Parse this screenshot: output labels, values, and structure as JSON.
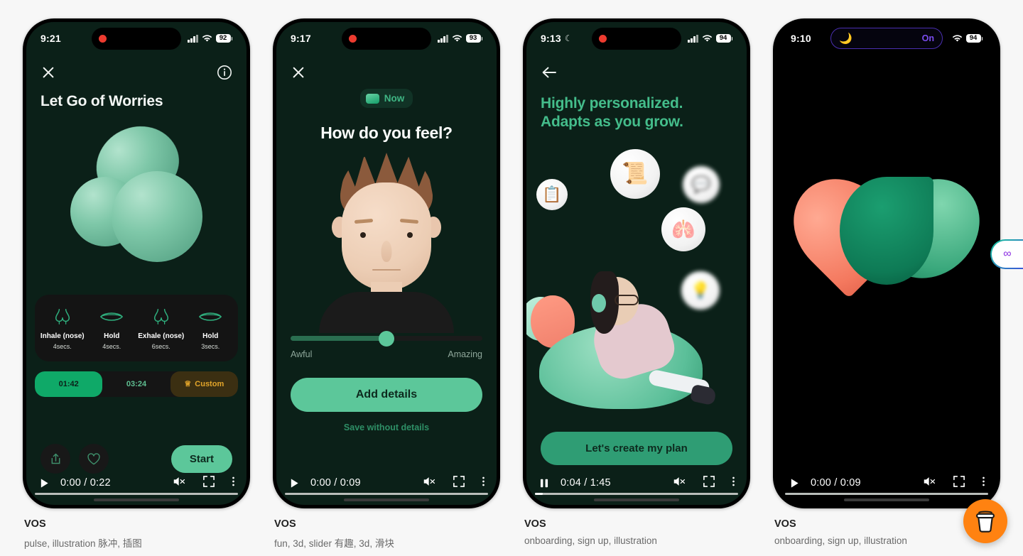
{
  "page": {
    "background": "#f7f7f7"
  },
  "cards": [
    {
      "status": {
        "time": "9:21",
        "battery": "92",
        "moon": ""
      },
      "nav": {
        "close_icon": "close-icon",
        "info_icon": "info-icon"
      },
      "title": "Let Go of Worries",
      "breath_steps": [
        {
          "name": "Inhale (nose)",
          "secs": "4secs.",
          "icon": "nose-icon"
        },
        {
          "name": "Hold",
          "secs": "4secs.",
          "icon": "lips-icon"
        },
        {
          "name": "Exhale (nose)",
          "secs": "6secs.",
          "icon": "nose-icon"
        },
        {
          "name": "Hold",
          "secs": "3secs.",
          "icon": "lips-icon"
        }
      ],
      "durations": [
        {
          "label": "01:42",
          "state": "active"
        },
        {
          "label": "03:24",
          "state": "normal"
        },
        {
          "label": "Custom",
          "state": "custom"
        }
      ],
      "actions": {
        "share_icon": "share-icon",
        "like_icon": "heart-icon",
        "start_label": "Start"
      },
      "video": {
        "current": "0:00",
        "duration": "0:22",
        "time_text": "0:00 / 0:22",
        "state": "paused",
        "progress_pct": 0
      },
      "caption": {
        "title": "VOS",
        "tags": "pulse, illustration 脉冲, 插图"
      }
    },
    {
      "status": {
        "time": "9:17",
        "battery": "93",
        "moon": ""
      },
      "nav": {
        "close_icon": "close-icon"
      },
      "now_pill": "Now",
      "question": "How do you feel?",
      "slider": {
        "value_pct": 50,
        "left_label": "Awful",
        "right_label": "Amazing"
      },
      "cta": "Add details",
      "sub_link": "Save without details",
      "video": {
        "current": "0:00",
        "duration": "0:09",
        "time_text": "0:00 / 0:09",
        "state": "paused",
        "progress_pct": 0
      },
      "caption": {
        "title": "VOS",
        "tags": "fun, 3d, slider 有趣, 3d, 滑块"
      }
    },
    {
      "status": {
        "time": "9:13",
        "battery": "94",
        "moon": "☾"
      },
      "nav": {
        "back_icon": "back-arrow-icon"
      },
      "headline_line1": "Highly personalized.",
      "headline_line2": "Adapts as you grow.",
      "cta": "Let's create my plan",
      "bubbles": [
        "clipboard-icon",
        "scroll-icon",
        "chat-icon",
        "lungs-icon",
        "blurred-icon"
      ],
      "video": {
        "current": "0:04",
        "duration": "1:45",
        "time_text": "0:04 / 1:45",
        "state": "playing",
        "progress_pct": 4
      },
      "caption": {
        "title": "VOS",
        "tags": "onboarding, sign up, illustration"
      }
    },
    {
      "status": {
        "time": "9:10",
        "battery": "94",
        "island_label": "On",
        "island_icon": "moon-icon"
      },
      "video": {
        "current": "0:00",
        "duration": "0:09",
        "time_text": "0:00 / 0:09",
        "state": "paused",
        "progress_pct": 0
      },
      "caption": {
        "title": "VOS",
        "tags": "onboarding, sign up, illustration"
      }
    }
  ],
  "floating": {
    "coffee_button": "buy-me-a-coffee-icon",
    "infinity_tab": "∞"
  },
  "colors": {
    "accent_green": "#5cc79a",
    "deep_green": "#0b2018",
    "gold": "#e3a52a",
    "coffee_orange": "#ff8211",
    "island_purple": "#7b4df0"
  }
}
